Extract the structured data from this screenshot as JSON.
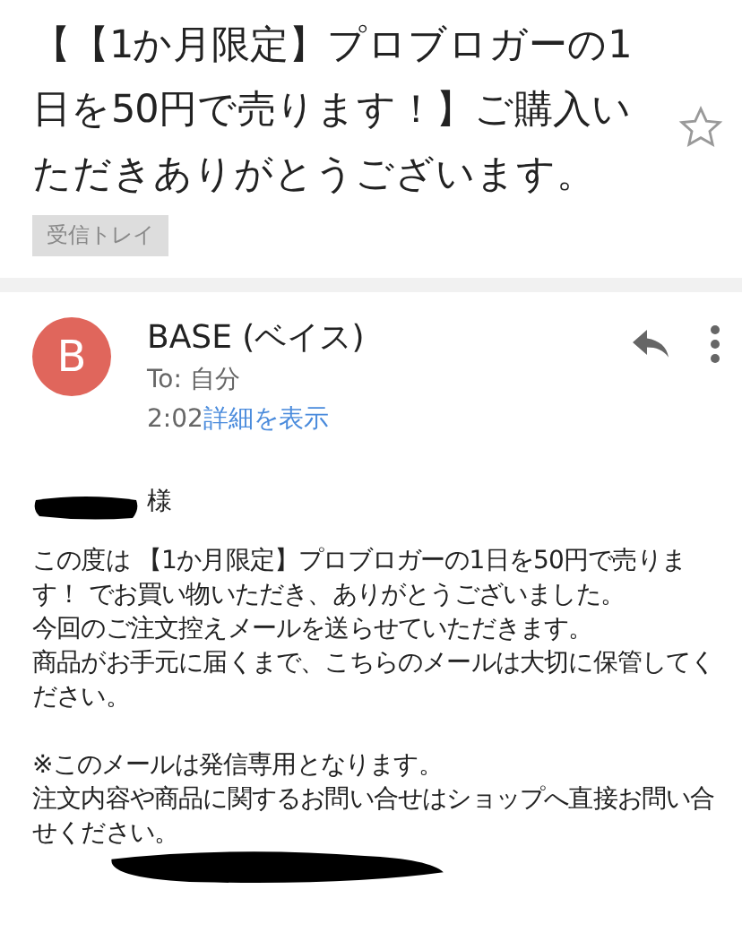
{
  "subject": "【【1か月限定】プロブロガーの1日を50円で売ります！】ご購入いただきありがとうございます。",
  "starred": false,
  "label": "受信トレイ",
  "sender": {
    "initial": "B",
    "name": "BASE (ベイス)",
    "to": "To: 自分",
    "time": "2:02",
    "details_link": "詳細を表示"
  },
  "body": {
    "salutation": "様",
    "sections": [
      [
        "この度は 【1か月限定】プロブロガーの1日を50円で売ります！ でお買い物いただき、ありがとうございました。",
        "今回のご注文控えメールを送らせていただきます。",
        "商品がお手元に届くまで、こちらのメールは大切に保管してください。"
      ],
      [
        "※このメールは発信専用となります。",
        "注文内容や商品に関するお問い合せはショップへ直接お問い合せください。"
      ]
    ]
  }
}
